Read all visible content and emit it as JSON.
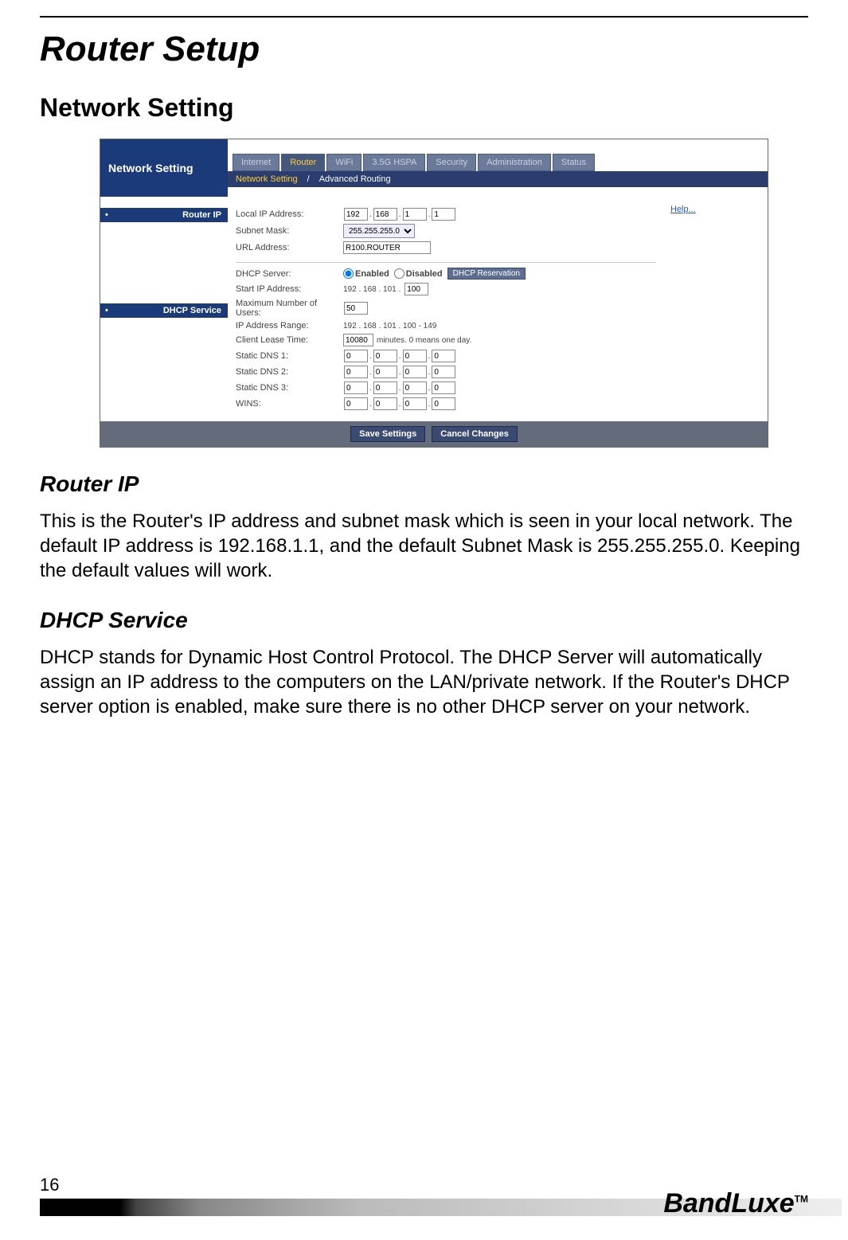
{
  "page": {
    "title": "Router Setup",
    "section": "Network Setting",
    "page_number": "16",
    "brand": "BandLuxe",
    "tm": "TM"
  },
  "ui": {
    "side_title": "Network Setting",
    "tabs": [
      "Internet",
      "Router",
      "WiFi",
      "3.5G HSPA",
      "Security",
      "Administration",
      "Status"
    ],
    "active_tab": "Router",
    "subtabs": {
      "active": "Network Setting",
      "sep": "/",
      "other": "Advanced Routing"
    },
    "help_label": "Help...",
    "sections": {
      "router_ip": {
        "label": "Router IP",
        "local_ip_label": "Local IP Address:",
        "local_ip": [
          "192",
          "168",
          "1",
          "1"
        ],
        "subnet_label": "Subnet Mask:",
        "subnet_value": "255.255.255.0",
        "url_label": "URL Address:",
        "url_value": "R100.ROUTER"
      },
      "dhcp": {
        "label": "DHCP Service",
        "server_label": "DHCP Server:",
        "enabled": "Enabled",
        "disabled": "Disabled",
        "reservation_btn": "DHCP Reservation",
        "start_ip_label": "Start IP Address:",
        "start_prefix": "192 . 168 . 101 .",
        "start_last": "100",
        "max_users_label": "Maximum Number of Users:",
        "max_users": "50",
        "range_label": "IP Address Range:",
        "range_value": "192 . 168 . 101 . 100 - 149",
        "lease_label": "Client Lease Time:",
        "lease_value": "10080",
        "lease_suffix": "minutes. 0 means one day.",
        "dns1_label": "Static DNS 1:",
        "dns2_label": "Static DNS 2:",
        "dns3_label": "Static DNS 3:",
        "wins_label": "WINS:",
        "zero_ip": [
          "0",
          "0",
          "0",
          "0"
        ]
      }
    },
    "footer": {
      "save": "Save Settings",
      "cancel": "Cancel Changes"
    }
  },
  "text": {
    "router_ip_heading": "Router IP",
    "router_ip_body": "This is the Router's IP address and subnet mask which is seen in your local network. The default IP address is 192.168.1.1, and the default Subnet Mask is 255.255.255.0. Keeping the default values will work.",
    "dhcp_heading": "DHCP Service",
    "dhcp_body": "DHCP stands for Dynamic Host Control Protocol. The DHCP Server will automatically assign an IP address to the computers on the LAN/private network. If the Router's DHCP server option is enabled, make sure there is no other DHCP server on your network."
  }
}
